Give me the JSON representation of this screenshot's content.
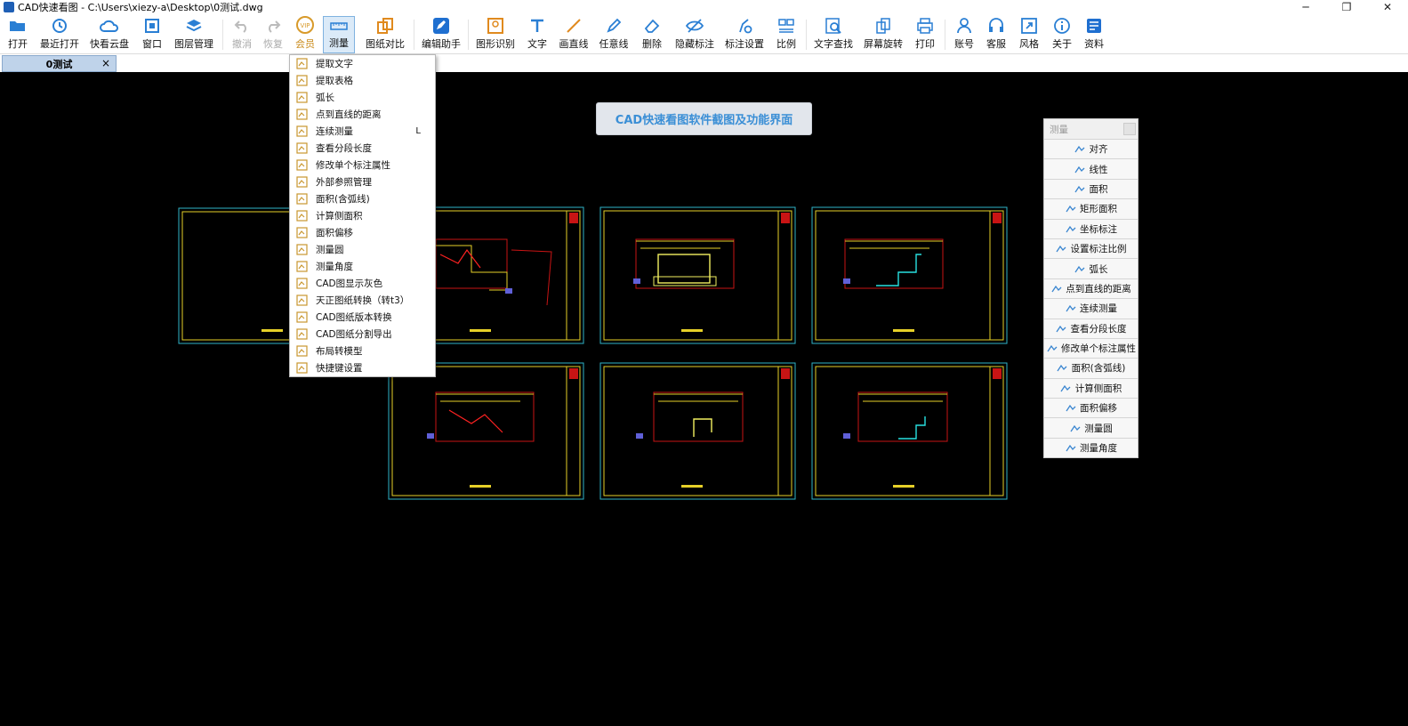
{
  "window": {
    "title": "CAD快速看图 - C:\\Users\\xiezy-a\\Desktop\\0测试.dwg",
    "controls": [
      "─",
      "❐",
      "✕"
    ]
  },
  "toolbar": {
    "open": "打开",
    "recent": "最近打开",
    "cloud": "快看云盘",
    "window": "窗口",
    "layers": "图层管理",
    "undo": "撤消",
    "redo": "恢复",
    "vip": "会员",
    "measure": "测量",
    "compare": "图纸对比",
    "editor": "编辑助手",
    "recognize": "图形识别",
    "text": "文字",
    "line": "画直线",
    "freeline": "任意线",
    "delete": "删除",
    "hide_annot": "隐藏标注",
    "annot_settings": "标注设置",
    "scale": "比例",
    "find_text": "文字查找",
    "rotate": "屏幕旋转",
    "print": "打印",
    "account": "账号",
    "service": "客服",
    "style": "风格",
    "about": "关于",
    "materials": "资料"
  },
  "tabs": [
    {
      "label": "0测试",
      "close": "×"
    }
  ],
  "banner": "CAD快速看图软件截图及功能界面",
  "menu": {
    "items": [
      {
        "label": "提取文字",
        "icon": "extract-text-icon"
      },
      {
        "label": "提取表格",
        "icon": "extract-table-icon"
      },
      {
        "label": "弧长",
        "icon": "arc-length-icon"
      },
      {
        "label": "点到直线的距离",
        "icon": "point-line-distance-icon"
      },
      {
        "label": "连续测量",
        "icon": "continuous-measure-icon",
        "shortcut": "L"
      },
      {
        "label": "查看分段长度",
        "icon": "segment-length-icon"
      },
      {
        "label": "修改单个标注属性",
        "icon": "edit-annotation-icon"
      },
      {
        "label": "外部参照管理",
        "icon": "xref-icon"
      },
      {
        "label": "面积(含弧线)",
        "icon": "area-arc-icon"
      },
      {
        "label": "计算侧面积",
        "icon": "side-area-icon"
      },
      {
        "label": "面积偏移",
        "icon": "area-offset-icon"
      },
      {
        "label": "测量圆",
        "icon": "measure-circle-icon"
      },
      {
        "label": "测量角度",
        "icon": "measure-angle-icon"
      },
      {
        "label": "CAD图显示灰色",
        "icon": "gray-display-icon"
      },
      {
        "label": "天正图纸转换（转t3）",
        "icon": "tangent-convert-icon"
      },
      {
        "label": "CAD图纸版本转换",
        "icon": "version-convert-icon"
      },
      {
        "label": "CAD图纸分割导出",
        "icon": "split-export-icon"
      },
      {
        "label": "布局转模型",
        "icon": "layout-model-icon"
      },
      {
        "label": "快捷键设置",
        "icon": "shortcut-settings-icon"
      }
    ]
  },
  "panel": {
    "title": "测量",
    "items": [
      {
        "label": "对齐"
      },
      {
        "label": "线性"
      },
      {
        "label": "面积"
      },
      {
        "label": "矩形面积"
      },
      {
        "label": "坐标标注"
      },
      {
        "label": "设置标注比例"
      },
      {
        "label": "弧长"
      },
      {
        "label": "点到直线的距离"
      },
      {
        "label": "连续测量"
      },
      {
        "label": "查看分段长度"
      },
      {
        "label": "修改单个标注属性"
      },
      {
        "label": "面积(含弧线)"
      },
      {
        "label": "计算侧面积"
      },
      {
        "label": "面积偏移"
      },
      {
        "label": "测量圆"
      },
      {
        "label": "测量角度"
      }
    ]
  },
  "colors": {
    "accent": "#3b8fd6",
    "sheet_frame": "#e6d028",
    "sheet_border": "#2fb3c8",
    "drawing_red": "#c81414"
  }
}
